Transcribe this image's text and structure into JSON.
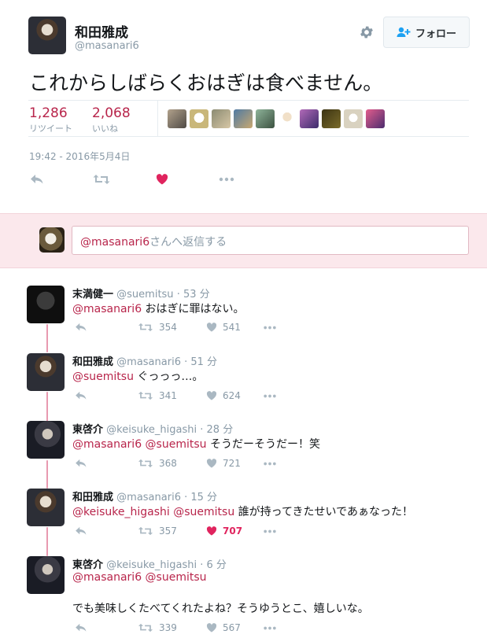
{
  "tweet": {
    "author_name": "和田雅成",
    "author_handle": "@masanari6",
    "follow_label": "フォロー",
    "text": "これからしばらくおはぎは食べません。",
    "retweets_count": "1,286",
    "retweets_label": "リツイート",
    "likes_count": "2,068",
    "likes_label": "いいね",
    "timestamp": "19:42 - 2016年5月4日"
  },
  "reply_box": {
    "mention": "@masanari6",
    "placeholder_rest": "さんへ返信する"
  },
  "replies": [
    {
      "name": "末満健一",
      "handle": "@suemitsu",
      "time": "· 53 分",
      "mentions": "@masanari6",
      "text": " おはぎに罪はない。",
      "retweets": "354",
      "likes": "541",
      "liked": false
    },
    {
      "name": "和田雅成",
      "handle": "@masanari6",
      "time": "· 51 分",
      "mentions": "@suemitsu",
      "text": " ぐっっっ…。",
      "retweets": "341",
      "likes": "624",
      "liked": false
    },
    {
      "name": "東啓介",
      "handle": "@keisuke_higashi",
      "time": "· 28 分",
      "mentions": "@masanari6 @suemitsu",
      "text": " そうだーそうだー！笑",
      "retweets": "368",
      "likes": "721",
      "liked": false
    },
    {
      "name": "和田雅成",
      "handle": "@masanari6",
      "time": "· 15 分",
      "mentions": "@keisuke_higashi @suemitsu",
      "text": " 誰が持ってきたせいであぁなった！",
      "retweets": "357",
      "likes": "707",
      "liked": true
    },
    {
      "name": "東啓介",
      "handle": "@keisuke_higashi",
      "time": "· 6 分",
      "mentions": "@masanari6 @suemitsu",
      "text2": "でも美味しくたべてくれたよね？そうゆうとこ、嬉しいな。",
      "retweets": "339",
      "likes": "567",
      "liked": false
    }
  ],
  "colors": {
    "accent": "#b8254b",
    "like_active": "#e0245e",
    "muted": "#8899a6",
    "reply_band": "#fbe8ec",
    "thread_line": "#e89ab0"
  }
}
